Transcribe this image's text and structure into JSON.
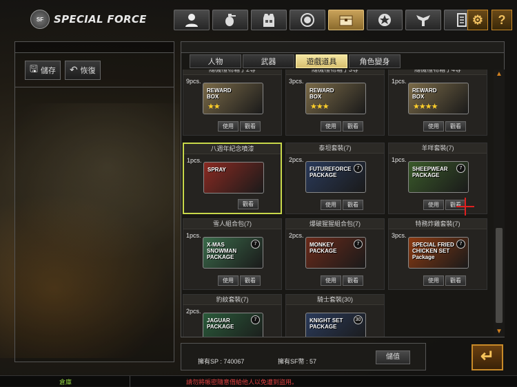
{
  "app": {
    "logo_text": "SPECIAL FORCE",
    "logo_badge": "SF"
  },
  "topbar": {
    "icons": [
      "character-icon",
      "grenade-icon",
      "vest-icon",
      "medal-icon",
      "chest-icon",
      "star-emblem-icon",
      "wings-icon",
      "document-icon"
    ],
    "active_index": 4,
    "settings_icon": "gear-icon",
    "help_label": "?"
  },
  "left": {
    "save_label": "儲存",
    "restore_label": "恢復"
  },
  "tabs": [
    {
      "label": "人物"
    },
    {
      "label": "武器"
    },
    {
      "label": "遊戲道具"
    },
    {
      "label": "角色變身"
    }
  ],
  "active_tab": 2,
  "items": [
    {
      "title": "隨機禮物箱子2等",
      "qty": "9pcs.",
      "img_label": "REWARD\nBOX",
      "stars": "★★",
      "color": "#7a6a48",
      "badge": "",
      "buttons": [
        "使用",
        "觀看"
      ]
    },
    {
      "title": "隨機禮物箱子3等",
      "qty": "3pcs.",
      "img_label": "REWARD\nBOX",
      "stars": "★★★",
      "color": "#7a6a48",
      "badge": "",
      "buttons": [
        "使用",
        "觀看"
      ]
    },
    {
      "title": "隨機禮物箱子4等",
      "qty": "1pcs.",
      "img_label": "REWARD\nBOX",
      "stars": "★★★★",
      "color": "#7a6a48",
      "badge": "",
      "buttons": [
        "使用",
        "觀看"
      ]
    },
    {
      "title": "八週年紀念噴漆",
      "qty": "1pcs.",
      "img_label": "SPRAY",
      "stars": "",
      "color": "#8a2a22",
      "badge": "",
      "buttons": [
        "觀看"
      ]
    },
    {
      "title": "泰坦套裝(7)",
      "qty": "2pcs.",
      "img_label": "FUTUREFORCE\nPACKAGE",
      "stars": "",
      "color": "#2a3a5a",
      "badge": "7",
      "buttons": [
        "使用",
        "觀看"
      ]
    },
    {
      "title": "羊咩套裝(7)",
      "qty": "1pcs.",
      "img_label": "SHEEPWEAR\nPACKAGE",
      "stars": "",
      "color": "#3a5a2a",
      "badge": "7",
      "buttons": [
        "使用",
        "觀看"
      ]
    },
    {
      "title": "雪人組合包(7)",
      "qty": "1pcs.",
      "img_label": "X-MAS\nSNOWMAN\nPACKAGE",
      "stars": "",
      "color": "#3a6a4a",
      "badge": "7",
      "buttons": [
        "使用",
        "觀看"
      ]
    },
    {
      "title": "爆破猩猩組合包(7)",
      "qty": "2pcs.",
      "img_label": "MONKEY\nPACKAGE",
      "stars": "",
      "color": "#6a2a1a",
      "badge": "7",
      "buttons": [
        "使用",
        "觀看"
      ]
    },
    {
      "title": "特務炸雞套裝(7)",
      "qty": "3pcs.",
      "img_label": "SPECIAL FRIED\nCHICKEN SET\nPackage",
      "stars": "",
      "color": "#8a3a12",
      "badge": "7",
      "buttons": [
        "使用",
        "觀看"
      ]
    },
    {
      "title": "豹紋套裝(7)",
      "qty": "2pcs.",
      "img_label": "JAGUAR\nPACKAGE",
      "stars": "",
      "color": "#2a5a3a",
      "badge": "7",
      "buttons": []
    },
    {
      "title": "騎士套裝(30)",
      "qty": "",
      "img_label": "KNIGHT SET\nPACKAGE",
      "stars": "",
      "color": "#2a3a5a",
      "badge": "30",
      "buttons": []
    }
  ],
  "money": {
    "sp_label": "擁有SP :",
    "sp_value": "740067",
    "sf_label": "擁有SF幣 :",
    "sf_value": "57",
    "charge_label": "儲值"
  },
  "back_icon": "return-arrow-icon",
  "status": {
    "left": "倉庫",
    "right": "請勿將帳密隨意借給他人以免遭到盜用。"
  }
}
